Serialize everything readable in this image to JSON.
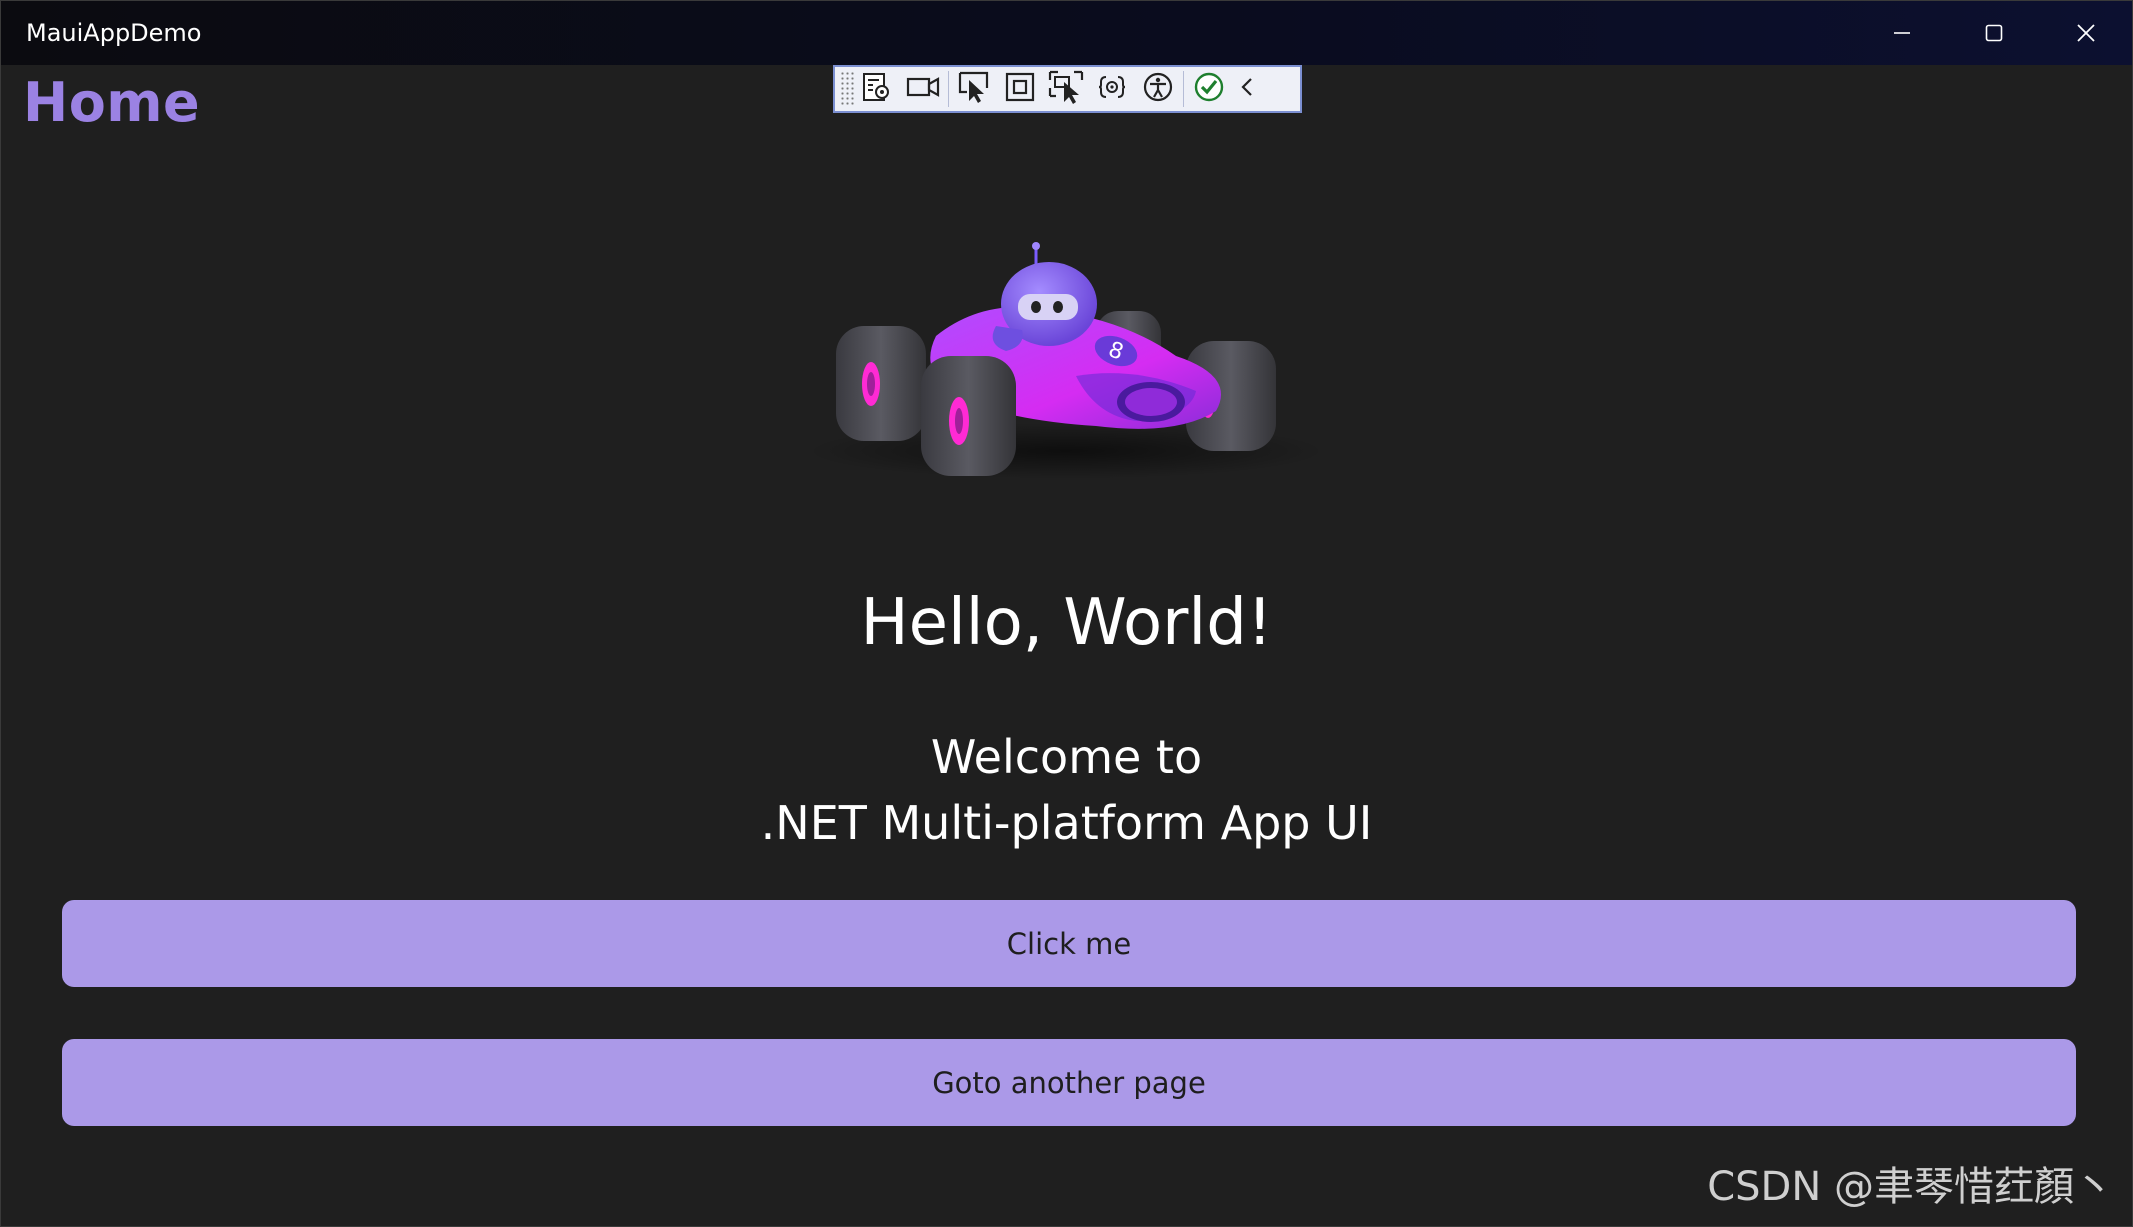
{
  "window": {
    "title": "MauiAppDemo",
    "controls": {
      "minimize_icon": "minimize-icon",
      "maximize_icon": "maximize-icon",
      "close_icon": "close-icon"
    }
  },
  "debug_toolbar": {
    "items": [
      "live-visual-tree-icon",
      "video-record-icon",
      "select-element-icon",
      "display-layout-adorners-icon",
      "track-focused-element-icon",
      "binding-failures-icon",
      "accessibility-checker-icon",
      "hot-reload-status-icon",
      "collapse-chevron-icon"
    ]
  },
  "page": {
    "title": "Home",
    "heading": "Hello, World!",
    "welcome_line1": "Welcome to",
    "welcome_line2": ".NET Multi-platform App UI",
    "buttons": {
      "click_label": "Click me",
      "goto_label": "Goto another page"
    }
  },
  "watermark": "CSDN @聿琴惜荭顏丶",
  "colors": {
    "accent": "#9b82e3",
    "button_bg": "#ab99e8",
    "background": "#1f1f1f"
  }
}
